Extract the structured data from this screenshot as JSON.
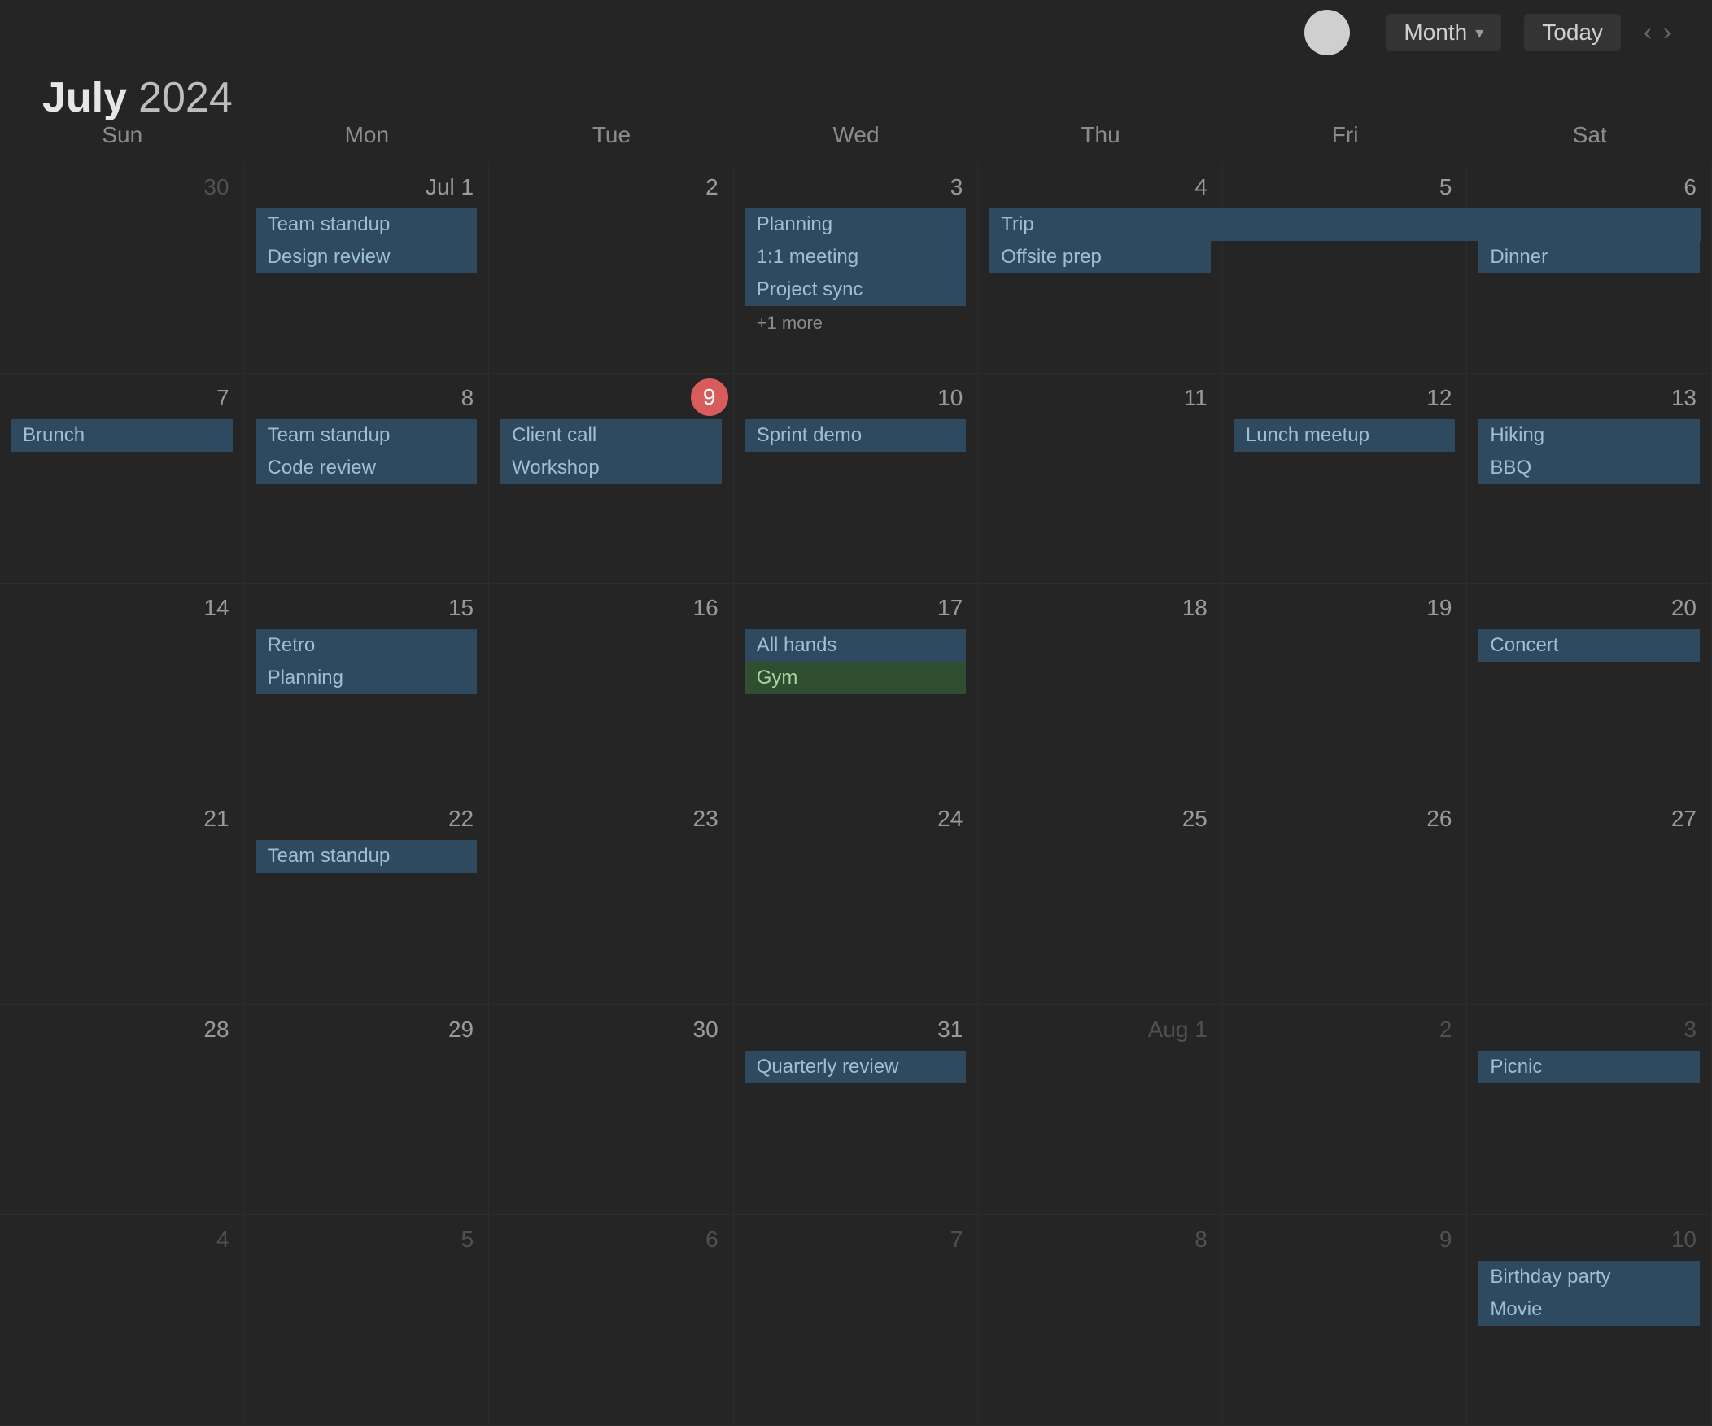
{
  "toolbar": {
    "calendar_label": "Month",
    "today_label": "Today",
    "prev_glyph": "‹",
    "next_glyph": "›"
  },
  "header": {
    "month": "July",
    "year": "2024"
  },
  "weekdays": [
    "Sun",
    "Mon",
    "Tue",
    "Wed",
    "Thu",
    "Fri",
    "Sat"
  ],
  "span_event": {
    "title": "Trip"
  },
  "days": [
    {
      "num": "30",
      "outside": true,
      "events": []
    },
    {
      "num": "Jul 1",
      "events": [
        "Team standup",
        "Design review"
      ]
    },
    {
      "num": "2",
      "events": []
    },
    {
      "num": "3",
      "events": [
        "Planning",
        "1:1 meeting",
        "Project sync"
      ],
      "more": "+1 more"
    },
    {
      "num": "4",
      "events": [
        "Offsite prep"
      ]
    },
    {
      "num": "5",
      "events": []
    },
    {
      "num": "6",
      "events": [
        "Dinner"
      ]
    },
    {
      "num": "7",
      "events": [
        "Brunch"
      ]
    },
    {
      "num": "8",
      "events": [
        "Team standup",
        "Code review"
      ]
    },
    {
      "num": "9",
      "today": true,
      "events": [
        "Client call",
        "Workshop"
      ]
    },
    {
      "num": "10",
      "events": [
        "Sprint demo"
      ]
    },
    {
      "num": "11",
      "events": []
    },
    {
      "num": "12",
      "events": [
        "Lunch meetup"
      ]
    },
    {
      "num": "13",
      "events": [
        "Hiking",
        "BBQ"
      ]
    },
    {
      "num": "14",
      "events": []
    },
    {
      "num": "15",
      "events": [
        "Retro",
        "Planning"
      ]
    },
    {
      "num": "16",
      "events": []
    },
    {
      "num": "17",
      "events": [
        "All hands",
        {
          "title": "Gym",
          "color": "green"
        }
      ]
    },
    {
      "num": "18",
      "events": []
    },
    {
      "num": "19",
      "events": []
    },
    {
      "num": "20",
      "events": [
        "Concert"
      ]
    },
    {
      "num": "21",
      "events": []
    },
    {
      "num": "22",
      "events": [
        "Team standup"
      ]
    },
    {
      "num": "23",
      "events": []
    },
    {
      "num": "24",
      "events": []
    },
    {
      "num": "25",
      "events": []
    },
    {
      "num": "26",
      "events": []
    },
    {
      "num": "27",
      "events": []
    },
    {
      "num": "28",
      "events": []
    },
    {
      "num": "29",
      "events": []
    },
    {
      "num": "30",
      "events": []
    },
    {
      "num": "31",
      "events": [
        "Quarterly review"
      ]
    },
    {
      "num": "Aug 1",
      "outside": true,
      "events": []
    },
    {
      "num": "2",
      "outside": true,
      "events": []
    },
    {
      "num": "3",
      "outside": true,
      "events": [
        "Picnic"
      ]
    },
    {
      "num": "4",
      "outside": true,
      "events": []
    },
    {
      "num": "5",
      "outside": true,
      "events": []
    },
    {
      "num": "6",
      "outside": true,
      "events": []
    },
    {
      "num": "7",
      "outside": true,
      "events": []
    },
    {
      "num": "8",
      "outside": true,
      "events": []
    },
    {
      "num": "9",
      "outside": true,
      "events": []
    },
    {
      "num": "10",
      "outside": true,
      "events": [
        "Birthday party",
        "Movie"
      ]
    }
  ]
}
